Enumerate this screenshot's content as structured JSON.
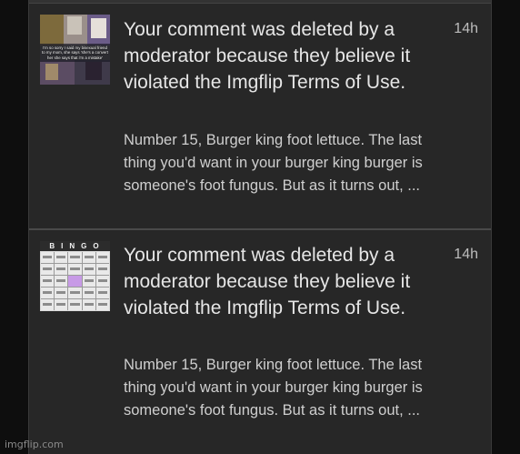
{
  "notifications": [
    {
      "thumbnail": "meme-collage-image",
      "thumbnail_caption": "I'm so sorry I said my bisexual friend to my mom, she says 'she's a convert her she says that i'm a mistake'",
      "title": "Your comment was deleted by a moderator because they believe it violated the Imgflip Terms of Use.",
      "time": "14h",
      "snippet": "Number 15, Burger king foot lettuce. The last thing you'd want in your burger king burger is someone's foot fungus. But as it turns out, ..."
    },
    {
      "thumbnail": "bingo-card-image",
      "thumbnail_caption": "BINGO",
      "title": "Your comment was deleted by a moderator because they believe it violated the Imgflip Terms of Use.",
      "time": "14h",
      "snippet": "Number 15, Burger king foot lettuce. The last thing you'd want in your burger king burger is someone's foot fungus. But as it turns out, ..."
    }
  ],
  "watermark": "imgflip.com"
}
